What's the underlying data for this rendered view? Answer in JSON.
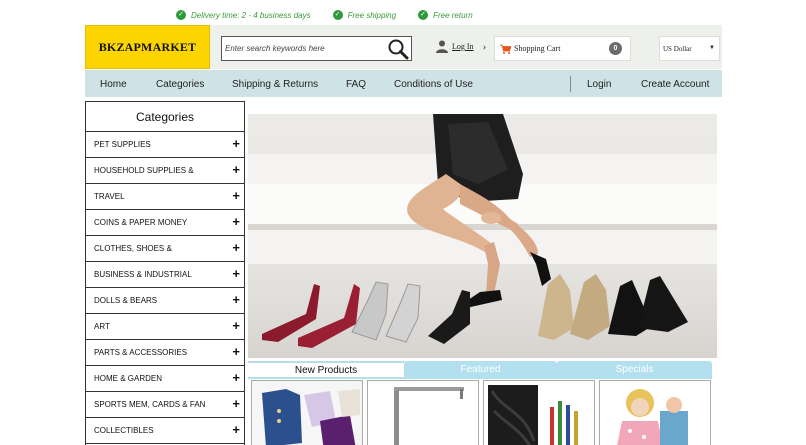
{
  "promo": {
    "items": [
      "Delivery time: 2 - 4 business days",
      "Free shipping",
      "Free return"
    ]
  },
  "header": {
    "logo": "BKZAPMARKET",
    "search_placeholder": "Enter search keywords here",
    "login_label": "Log In",
    "cart_label": "Shopping Cart",
    "cart_count": "0",
    "currency": "US Dollar"
  },
  "nav": {
    "home": "Home",
    "categories": "Categories",
    "shipping": "Shipping & Returns",
    "faq": "FAQ",
    "conditions": "Conditions of Use",
    "login": "Login",
    "create_account": "Create Account"
  },
  "sidebar": {
    "title": "Categories",
    "items": [
      "PET SUPPLIES",
      "HOUSEHOLD SUPPLIES &",
      "TRAVEL",
      "COINS & PAPER MONEY",
      "CLOTHES, SHOES &",
      "BUSINESS & INDUSTRIAL",
      "DOLLS & BEARS",
      "ART",
      "PARTS & ACCESSORIES",
      "HOME & GARDEN",
      "SPORTS MEM, CARDS & FAN",
      "COLLECTIBLES"
    ]
  },
  "tabs": {
    "new_products": "New Products",
    "featured": "Featured",
    "specials": "Specials"
  },
  "colors": {
    "logo_bg": "#fcd500",
    "nav_bg": "#cfe3e6",
    "tab_bg": "#b3e0ee",
    "promo_green": "#2e9a3a"
  }
}
